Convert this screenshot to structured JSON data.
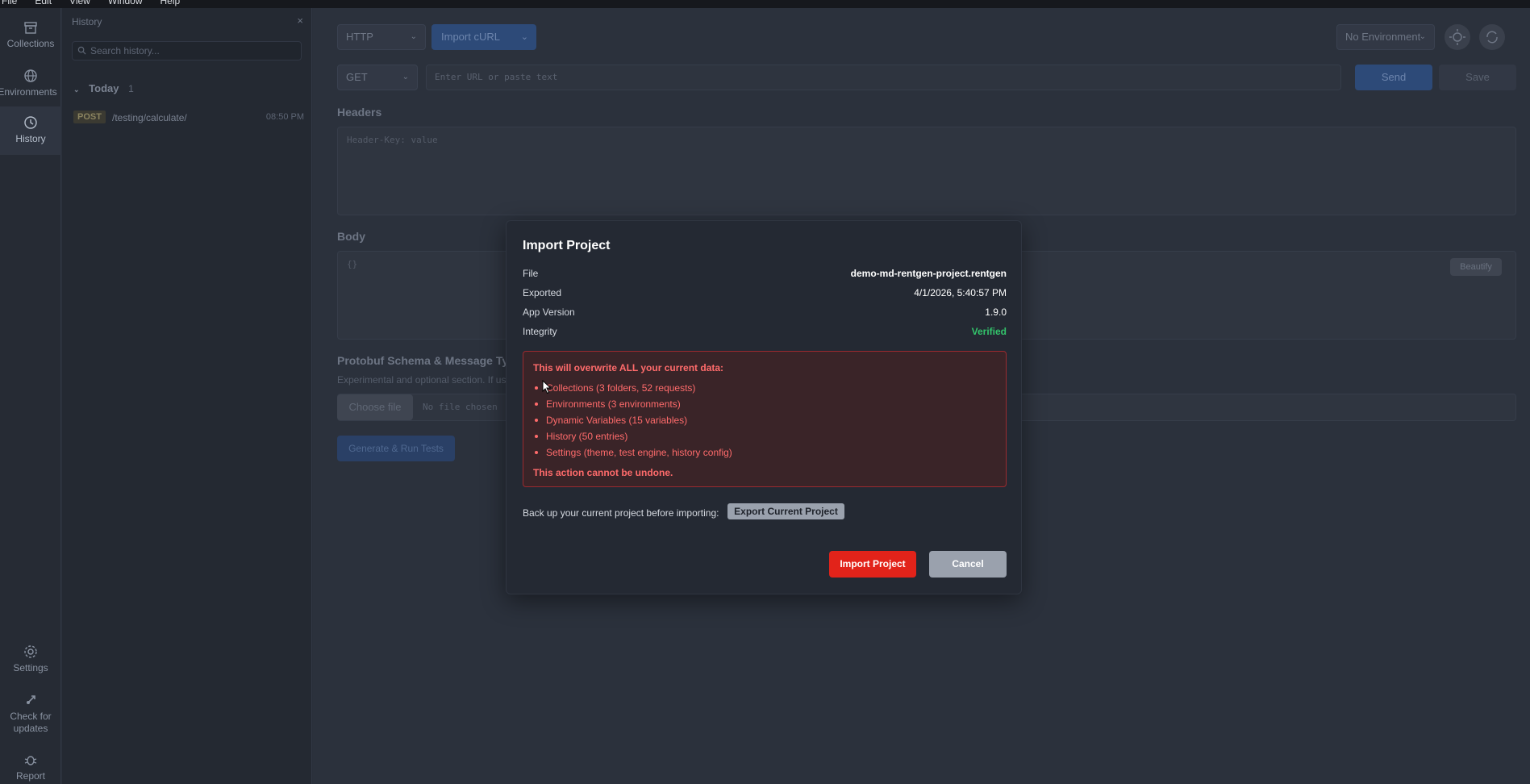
{
  "menubar": {
    "items": [
      "File",
      "Edit",
      "View",
      "Window",
      "Help"
    ]
  },
  "rail": {
    "collections": "Collections",
    "environments": "Environments",
    "history": "History",
    "settings": "Settings",
    "updates": "Check for updates",
    "report": "Report"
  },
  "history_panel": {
    "title": "History",
    "close": "×",
    "search_placeholder": "Search history...",
    "group_label": "Today",
    "group_count": "1",
    "entries": [
      {
        "method": "POST",
        "path": "/testing/calculate/",
        "time": "08:50 PM"
      }
    ]
  },
  "toolbar": {
    "protocol": "HTTP",
    "import_curl": "Import cURL",
    "environment": "No Environment"
  },
  "request": {
    "method": "GET",
    "url_placeholder": "Enter URL or paste text",
    "send": "Send",
    "save": "Save"
  },
  "headers": {
    "label": "Headers",
    "placeholder": "Header-Key: value"
  },
  "body": {
    "label": "Body",
    "value": "{}",
    "beautify": "Beautify"
  },
  "protobuf": {
    "label": "Protobuf Schema & Message Type",
    "note": "Experimental and optional section. If used,",
    "choose_file": "Choose file",
    "no_file": "No file chosen"
  },
  "generate": "Generate & Run Tests",
  "modal": {
    "title": "Import Project",
    "rows": [
      {
        "key": "File",
        "value": "demo-md-rentgen-project.rentgen"
      },
      {
        "key": "Exported",
        "value": "4/1/2026, 5:40:57 PM"
      },
      {
        "key": "App Version",
        "value": "1.9.0"
      },
      {
        "key": "Integrity",
        "value": "Verified"
      }
    ],
    "warning_title": "This will overwrite ALL your current data:",
    "warning_items": [
      "Collections (3 folders, 52 requests)",
      "Environments (3 environments)",
      "Dynamic Variables (15 variables)",
      "History (50 entries)",
      "Settings (theme, test engine, history config)"
    ],
    "warning_footer": "This action cannot be undone.",
    "backup_label": "Back up your current project before importing:",
    "export_button": "Export Current Project",
    "import_button": "Import Project",
    "cancel_button": "Cancel"
  },
  "colors": {
    "danger": "#e2231a",
    "warning_text": "#ff6b6b",
    "verified": "#33c36b",
    "modal_bg": "#242933"
  }
}
